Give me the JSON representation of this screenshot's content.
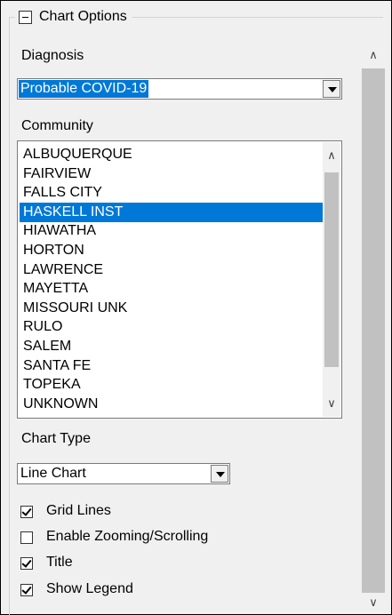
{
  "group": {
    "title": "Chart Options"
  },
  "diagnosis": {
    "label": "Diagnosis",
    "value": "Probable COVID-19"
  },
  "community": {
    "label": "Community",
    "items": [
      "ALBUQUERQUE",
      "FAIRVIEW",
      "FALLS CITY",
      "HASKELL INST",
      "HIAWATHA",
      "HORTON",
      "LAWRENCE",
      "MAYETTA",
      "MISSOURI UNK",
      "RULO",
      "SALEM",
      "SANTA FE",
      "TOPEKA",
      "UNKNOWN"
    ],
    "selected_index": 3
  },
  "chart_type": {
    "label": "Chart Type",
    "value": "Line Chart"
  },
  "checkboxes": [
    {
      "label": "Grid Lines",
      "checked": true
    },
    {
      "label": "Enable Zooming/Scrolling",
      "checked": false
    },
    {
      "label": "Title",
      "checked": true
    },
    {
      "label": "Show Legend",
      "checked": true
    }
  ],
  "colors": {
    "selection": "#0078d7",
    "panel": "#f0f0f0"
  }
}
